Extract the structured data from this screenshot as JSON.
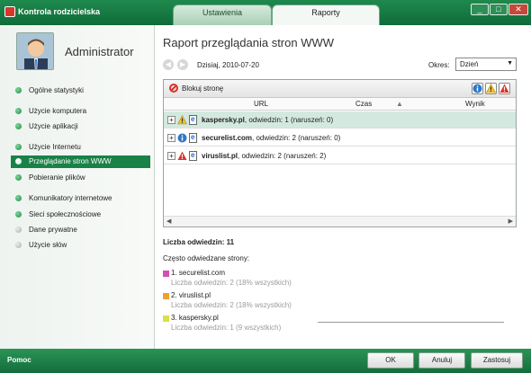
{
  "window": {
    "title": "Kontrola rodzicielska"
  },
  "tabs": [
    {
      "label": "Ustawienia"
    },
    {
      "label": "Raporty"
    }
  ],
  "user": {
    "name": "Administrator"
  },
  "sidebar": {
    "items": [
      {
        "label": "Ogólne statystyki"
      },
      {
        "label": "Użycie komputera"
      },
      {
        "label": "Użycie aplikacji"
      },
      {
        "label": "Użycie Internetu"
      },
      {
        "label": "Przeglądanie stron WWW"
      },
      {
        "label": "Pobieranie plików"
      },
      {
        "label": "Komunikatory internetowe"
      },
      {
        "label": "Sieci społecznościowe"
      },
      {
        "label": "Dane prywatne"
      },
      {
        "label": "Użycie słów"
      }
    ]
  },
  "report": {
    "title": "Raport przeglądania stron WWW",
    "date": "Dzisiaj, 2010-07-20",
    "period_label": "Okres:",
    "period_value": "Dzień",
    "block_label": "Blokuj stronę",
    "columns": [
      "URL",
      "Czas",
      "Wynik"
    ],
    "rows": [
      {
        "site": "kaspersky.pl",
        "info": ", odwiedzin: 1 (naruszeń: 0)",
        "status_icon": "warning-icon"
      },
      {
        "site": "securelist.com",
        "info": ", odwiedzin: 2 (naruszeń: 0)",
        "status_icon": "info-icon"
      },
      {
        "site": "viruslist.pl",
        "info": ", odwiedzin: 2 (naruszeń: 2)",
        "status_icon": "alert-icon"
      }
    ],
    "visits_count": "Liczba odwiedzin: 11",
    "frequent_label": "Często odwiedzane strony:",
    "frequent": [
      {
        "name": "1. securelist.com",
        "detail": "Liczba odwiedzin: 2 (18% wszystkich)",
        "color": "#d64fb0"
      },
      {
        "name": "2. viruslist.pl",
        "detail": "Liczba odwiedzin: 2 (18% wszystkich)",
        "color": "#f0a030"
      },
      {
        "name": "3. kaspersky.pl",
        "detail": "Liczba odwiedzin: 1 (9 wszystkich)",
        "color": "#d9e04a"
      }
    ]
  },
  "footer": {
    "help": "Pomoc",
    "ok": "OK",
    "cancel": "Anuluj",
    "apply": "Zastosuj"
  },
  "colors": {
    "brand_green": "#1a8147",
    "warning": "#f2c230",
    "info": "#2f78c8",
    "alert": "#d7352b"
  }
}
